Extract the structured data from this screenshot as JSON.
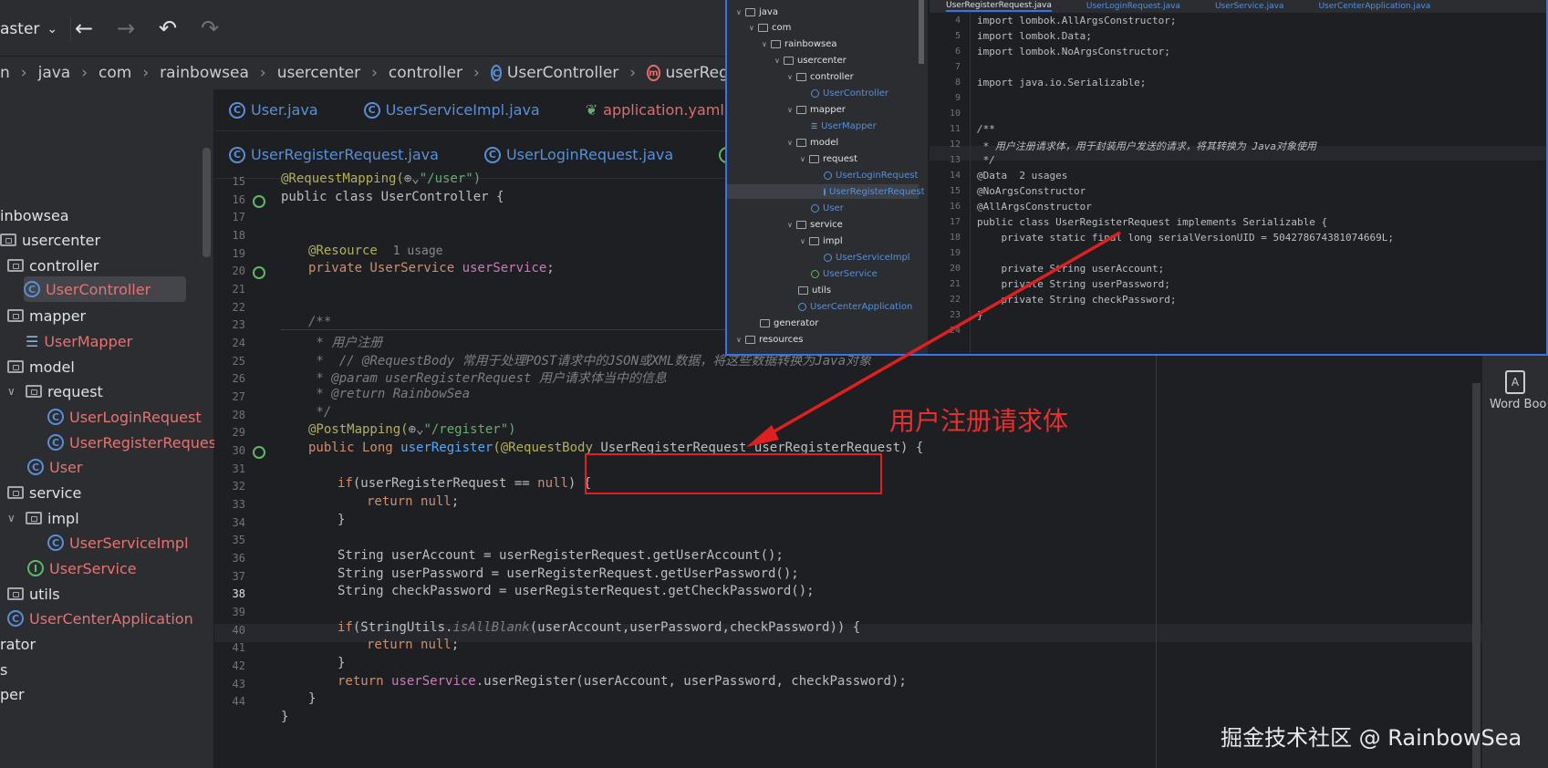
{
  "toolbar": {
    "branch": "aster",
    "branch_caret": "⌄",
    "back": "←",
    "forward": "→",
    "undo": "↶",
    "redo": "↷"
  },
  "breadcrumb": [
    "n",
    "java",
    "com",
    "rainbowsea",
    "usercenter",
    "controller",
    "UserController",
    "userRegister"
  ],
  "breadcrumb_sep": "›",
  "tabs_row1": [
    "User.java",
    "UserServiceImpl.java",
    "application.yaml"
  ],
  "tabs_row2": [
    "UserRegisterRequest.java",
    "UserLoginRequest.java",
    "U"
  ],
  "tree": {
    "items": [
      "inbowsea",
      "usercenter",
      "controller",
      "UserController",
      "mapper",
      "UserMapper",
      "model",
      "request",
      "UserLoginRequest",
      "UserRegisterRequest",
      "User",
      "service",
      "impl",
      "UserServiceImpl",
      "UserService",
      "utils",
      "UserCenterApplication",
      "rator",
      "s",
      "per"
    ]
  },
  "editor": {
    "line_numbers": [
      "15",
      "16",
      "17",
      "18",
      "19",
      "20",
      "21",
      "22",
      "23",
      "24",
      "25",
      "26",
      "27",
      "28",
      "29",
      "30",
      "31",
      "32",
      "33",
      "34",
      "35",
      "36",
      "37",
      "38",
      "39",
      "40",
      "41",
      "42",
      "43",
      "44"
    ],
    "lines": {
      "l15_a": "@RequestMapping(",
      "l15_b": "\"/user\")",
      "l16": "public class UserController {",
      "l19_a": "@Resource",
      "l19_hint": "1 usage",
      "l20_a": "private UserService ",
      "l20_b": "userService",
      "l20_c": ";",
      "l23": "/**",
      "l24": " * 用户注册",
      "l25": " *  // @RequestBody 常用于处理POST请求中的JSON或XML数据，将这些数据转换为Java对象",
      "l26_a": " * @param ",
      "l26_b": "userRegisterRequest",
      "l26_c": " 用户请求体当中的信息",
      "l27_a": " * @return ",
      "l27_b": "RainbowSea",
      "l28": " */",
      "l29_a": "@PostMapping(",
      "l29_b": "\"/register\")",
      "l30_a": "public Long ",
      "l30_b": "userRegister",
      "l30_c": "(@RequestBody ",
      "l30_d": "UserRegisterRequest userRegisterRequest) {",
      "l32_a": "if",
      "l32_b": "(userRegisterRequest == ",
      "l32_c": "null",
      "l32_d": ") {",
      "l33_a": "return ",
      "l33_b": "null",
      "l33_c": ";",
      "l34": "}",
      "l36": "String userAccount = userRegisterRequest.getUserAccount();",
      "l37": "String userPassword = userRegisterRequest.getUserPassword();",
      "l38": "String checkPassword = userRegisterRequest.getCheckPassword();",
      "l40_a": "if",
      "l40_b": "(StringUtils.",
      "l40_c": "isAllBlank",
      "l40_d": "(userAccount,userPassword,checkPassword)) {",
      "l41_a": "return ",
      "l41_b": "null",
      "l41_c": ";",
      "l42": "}",
      "l43_a": "return ",
      "l43_b": "userService",
      "l43_c": ".userRegister(userAccount, userPassword, checkPassword);",
      "l44": "}",
      "l45": "}"
    }
  },
  "annotation_label": "用户注册请求体",
  "right_strip": {
    "word_label": "Word Boo",
    "word_icon": "A"
  },
  "overlay": {
    "tabs": [
      "UserRegisterRequest.java",
      "UserLoginRequest.java",
      "UserService.java",
      "UserCenterApplication.java"
    ],
    "tree": [
      "java",
      "com",
      "rainbowsea",
      "usercenter",
      "controller",
      "UserController",
      "mapper",
      "UserMapper",
      "model",
      "request",
      "UserLoginRequest",
      "UserRegisterRequest",
      "User",
      "service",
      "impl",
      "UserServiceImpl",
      "UserService",
      "utils",
      "UserCenterApplication",
      "generator",
      "resources"
    ],
    "line_numbers": [
      "4",
      "5",
      "6",
      "7",
      "8",
      "9",
      "10",
      "11",
      "12",
      "13",
      "14",
      "15",
      "16",
      "17",
      "18",
      "19",
      "20",
      "21",
      "22",
      "23",
      "24"
    ],
    "code": [
      "import lombok.AllArgsConstructor;",
      "import lombok.Data;",
      "import lombok.NoArgsConstructor;",
      "",
      "import java.io.Serializable;",
      "",
      "",
      "/**",
      " * 用户注册请求体，用于封装用户发送的请求，将其转换为 Java对象使用",
      " */",
      "@Data  2 usages",
      "@NoArgsConstructor",
      "@AllArgsConstructor",
      "public class UserRegisterRequest implements Serializable {",
      "    private static final long serialVersionUID = 504278674381074669L;",
      "",
      "    private String userAccount;",
      "    private String userPassword;",
      "    private String checkPassword;",
      "}",
      ""
    ]
  },
  "watermark": "掘金技术社区 @ RainbowSea",
  "colors": {
    "bg": "#1e1f22",
    "panel": "#2b2d30",
    "accent": "#3574f0",
    "highlight": "#e02020"
  }
}
